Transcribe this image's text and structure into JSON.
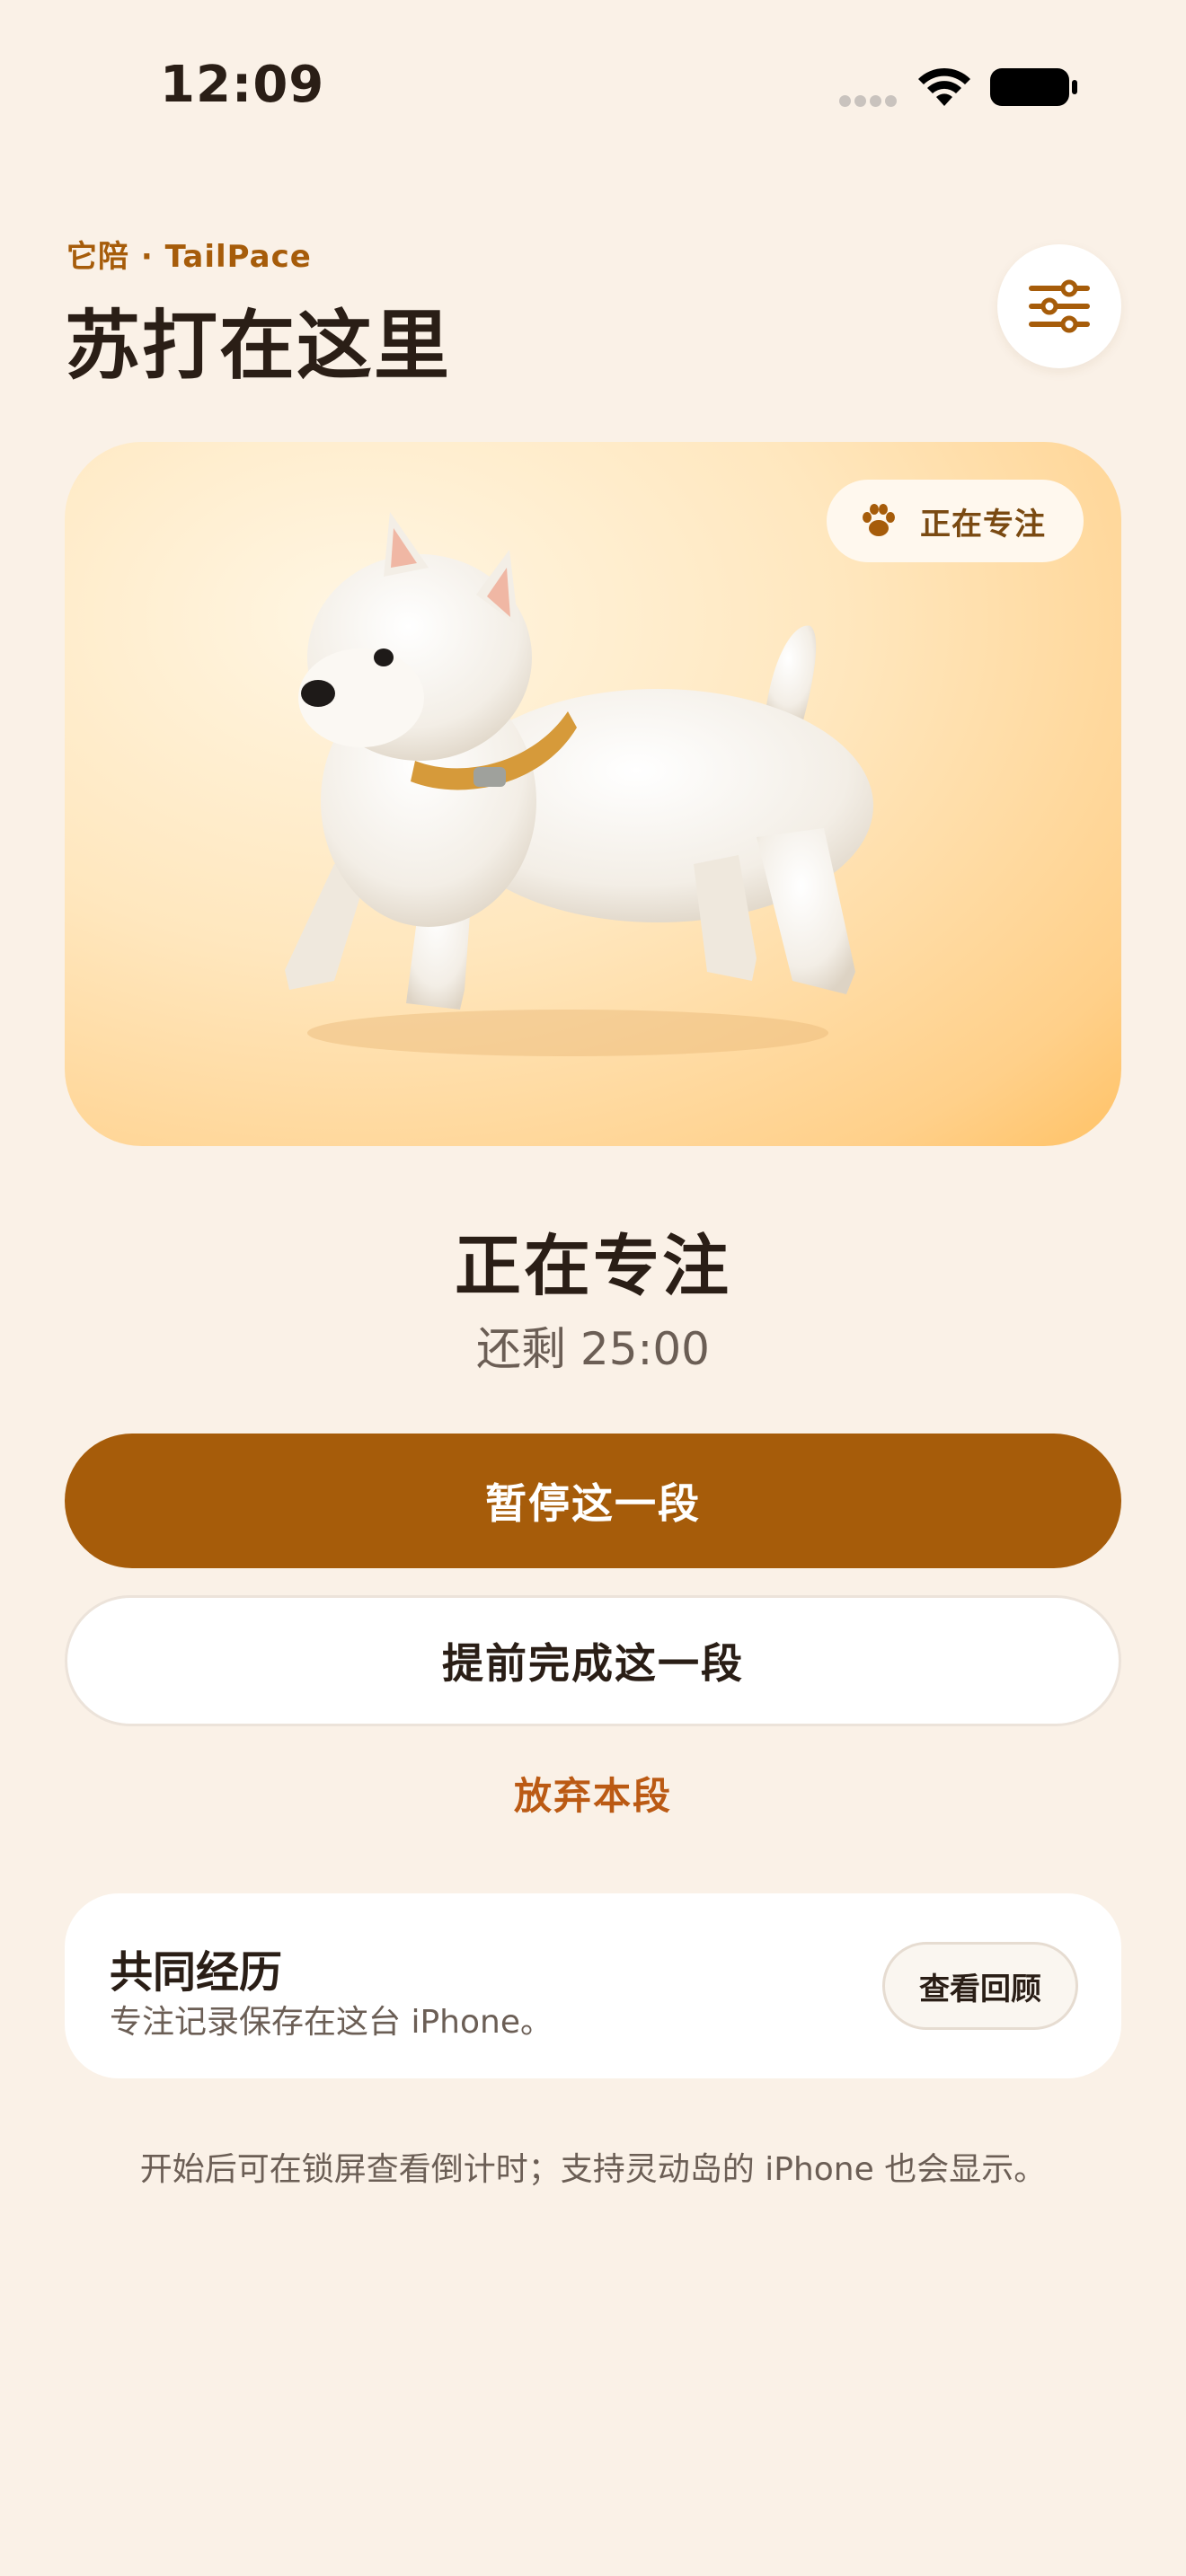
{
  "status_bar": {
    "time": "12:09"
  },
  "header": {
    "brand": "它陪 · TailPace",
    "title": "苏打在这里",
    "settings_icon": "sliders-icon"
  },
  "hero": {
    "badge_label": "正在专注",
    "badge_icon": "paw-icon"
  },
  "focus": {
    "title": "正在专注",
    "remaining": "还剩 25:00"
  },
  "actions": {
    "pause": "暂停这一段",
    "finish_early": "提前完成这一段",
    "abandon": "放弃本段"
  },
  "history": {
    "title": "共同经历",
    "subtitle": "专注记录保存在这台 iPhone。",
    "review_button": "查看回顾"
  },
  "footnote": "开始后可在锁屏查看倒计时；支持灵动岛的 iPhone 也会显示。",
  "colors": {
    "background": "#FAF1E7",
    "accent": "#A65C0A",
    "abandon": "#BB5A14"
  }
}
